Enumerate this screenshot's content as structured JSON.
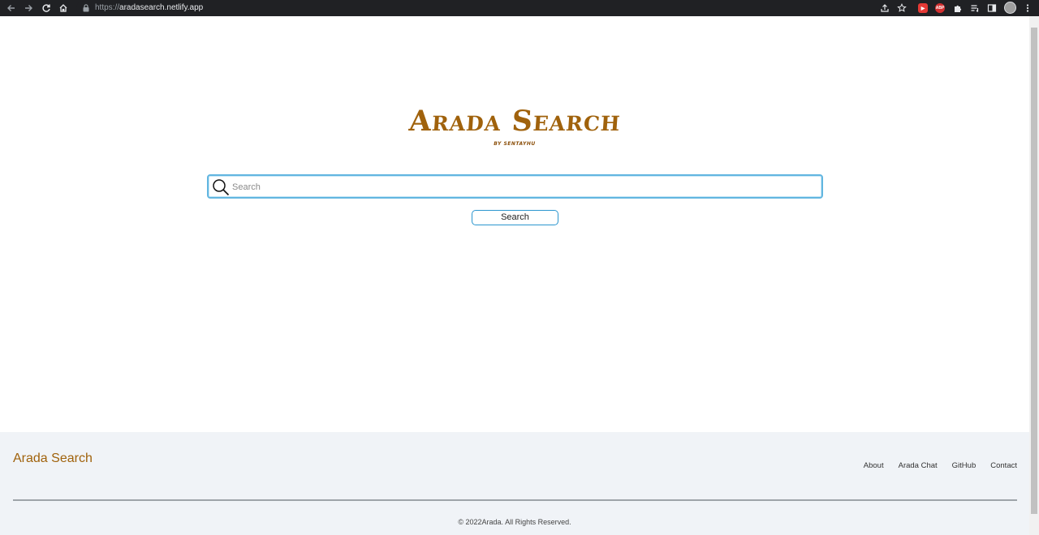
{
  "browser": {
    "url_scheme": "https://",
    "url_host": "aradasearch.netlify.app",
    "extensions": {
      "red_ext_label": "▶",
      "abp_label": "ABP"
    }
  },
  "logo": {
    "title": "Arada Search",
    "subtitle": "BY SENTAYHU"
  },
  "search": {
    "placeholder": "Search",
    "value": "",
    "button_label": "Search"
  },
  "footer": {
    "brand": "Arada Search",
    "links": [
      "About",
      "Arada Chat",
      "GitHub",
      "Contact"
    ],
    "copyright": "© 2022Arada. All Rights Reserved."
  },
  "colors": {
    "brand": "#a0620c",
    "accent": "#2b96cf",
    "footer_bg": "#f0f3f7"
  }
}
